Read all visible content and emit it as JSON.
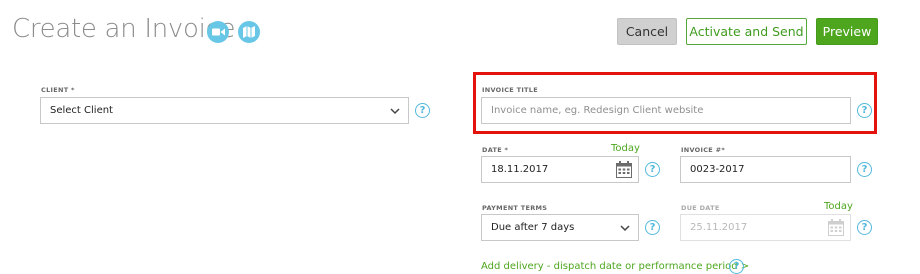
{
  "header": {
    "title": "Create an Invoice",
    "icons": [
      "video-icon",
      "map-icon"
    ],
    "cancel_label": "Cancel",
    "activate_label": "Activate and Send",
    "preview_label": "Preview"
  },
  "client": {
    "label": "CLIENT *",
    "value": "Select Client"
  },
  "invoice_title": {
    "label": "INVOICE TITLE",
    "placeholder": "Invoice name, eg. Redesign Client website"
  },
  "date": {
    "label": "DATE *",
    "today_label": "Today",
    "value": "18.11.2017"
  },
  "invoice_number": {
    "label": "INVOICE #*",
    "value": "0023-2017"
  },
  "payment_terms": {
    "label": "PAYMENT TERMS",
    "value": "Due after 7 days"
  },
  "due_date": {
    "label": "DUE DATE",
    "today_label": "Today",
    "value": "25.11.2017"
  },
  "delivery_link": "Add delivery - dispatch date or performance period >",
  "help_glyph": "?",
  "colors": {
    "accent_green": "#4ea61f",
    "help_blue": "#52b9dc",
    "highlight_red": "#e3120b"
  }
}
